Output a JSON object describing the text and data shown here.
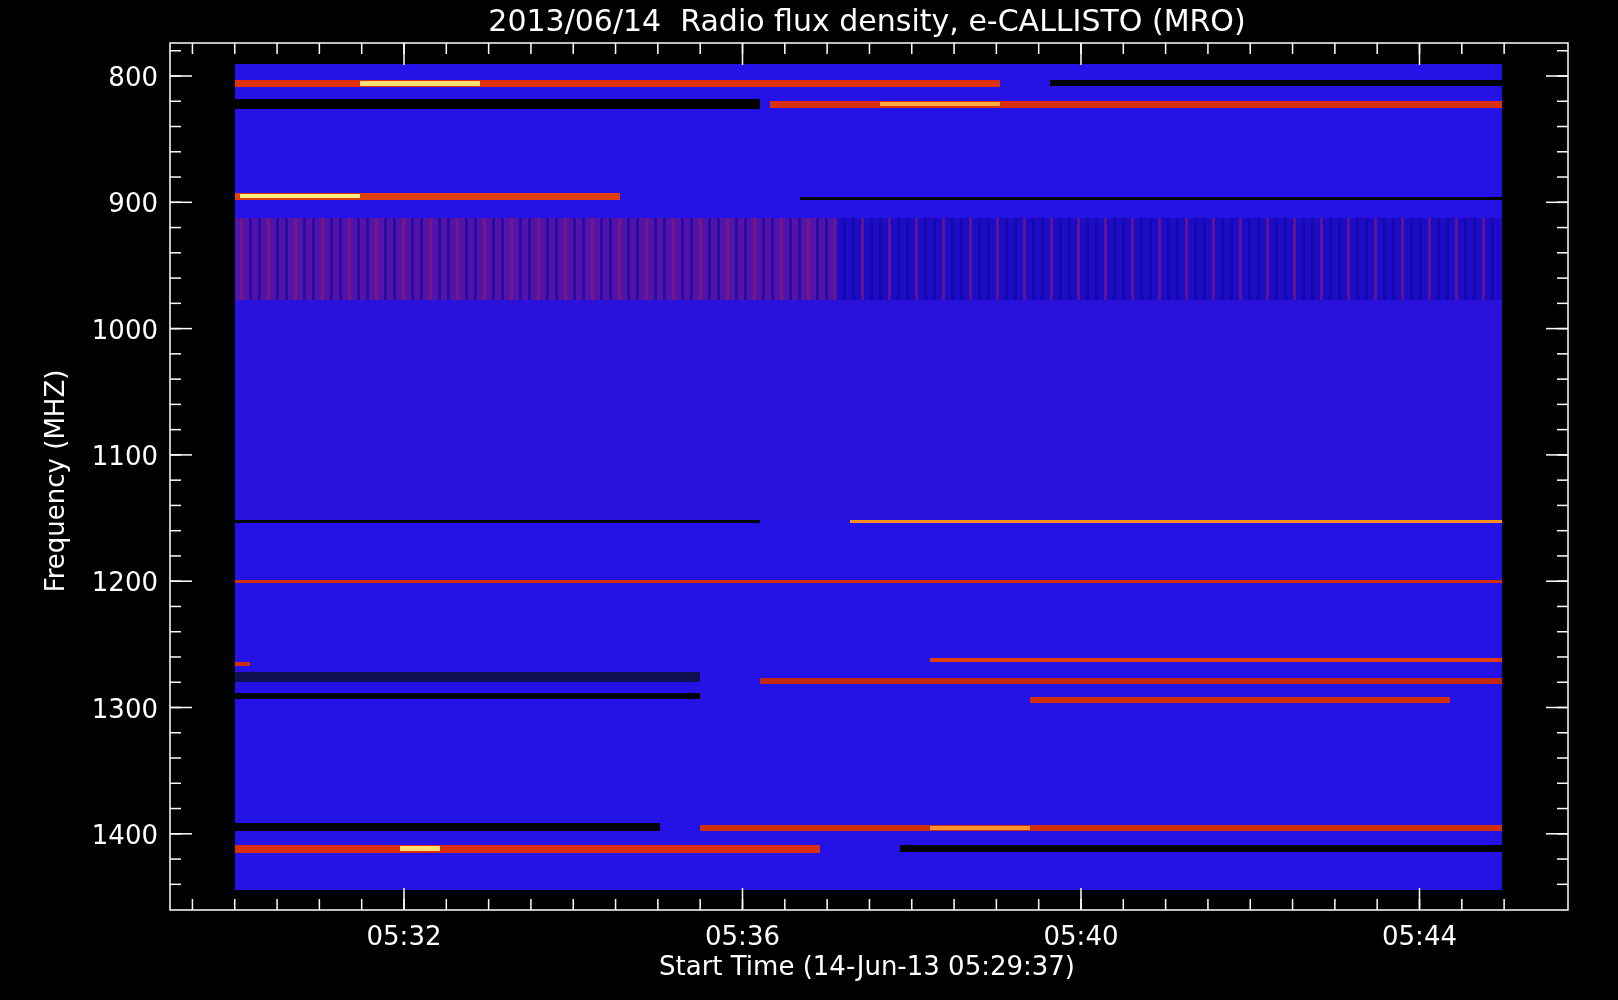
{
  "plot": {
    "title": "2013/06/14  Radio flux density, e-CALLISTO (MRO)",
    "y_axis": {
      "label": "Frequency (MHZ)",
      "ticks": [
        "800",
        "900",
        "1000",
        "1100",
        "1200",
        "1300",
        "1400"
      ]
    },
    "x_axis": {
      "label": "Start Time (14-Jun-13 05:29:37)",
      "ticks": [
        "05:32",
        "05:36",
        "05:40",
        "05:44"
      ]
    }
  }
}
